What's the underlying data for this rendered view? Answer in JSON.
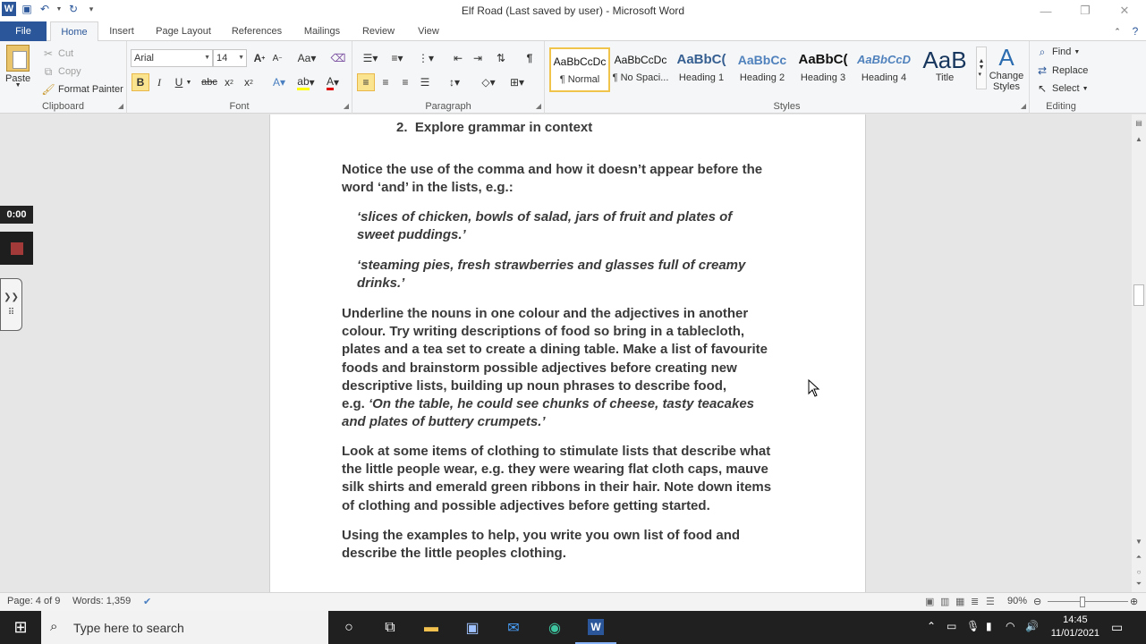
{
  "titlebar": {
    "title": "Elf Road (Last saved by user)  -  Microsoft Word",
    "logo": "W"
  },
  "tabs": [
    "File",
    "Home",
    "Insert",
    "Page Layout",
    "References",
    "Mailings",
    "Review",
    "View"
  ],
  "ribbon": {
    "clipboard": {
      "label": "Clipboard",
      "paste": "Paste",
      "cut": "Cut",
      "copy": "Copy",
      "format_painter": "Format Painter"
    },
    "font": {
      "label": "Font",
      "font_name": "Arial",
      "font_size": "14"
    },
    "paragraph": {
      "label": "Paragraph"
    },
    "styles": {
      "label": "Styles",
      "items": [
        {
          "preview": "AaBbCcDc",
          "name": "¶ Normal"
        },
        {
          "preview": "AaBbCcDc",
          "name": "¶ No Spaci..."
        },
        {
          "preview": "AaBbC(",
          "name": "Heading 1"
        },
        {
          "preview": "AaBbCc",
          "name": "Heading 2"
        },
        {
          "preview": "AaBbC(",
          "name": "Heading 3"
        },
        {
          "preview": "AaBbCcD",
          "name": "Heading 4"
        },
        {
          "preview": "AaB",
          "name": "Title"
        }
      ],
      "change_styles": "Change Styles"
    },
    "editing": {
      "label": "Editing",
      "find": "Find",
      "replace": "Replace",
      "select": "Select"
    }
  },
  "document": {
    "heading": {
      "number": "2.",
      "text": "Explore grammar in context"
    },
    "p1": [
      "Notice the use of the comma and how it doesn’t appear before the",
      "word ‘and’ in the lists, e.g.:"
    ],
    "q1": [
      "‘slices of chicken, bowls of salad, jars of fruit and plates of",
      "sweet puddings.’"
    ],
    "q2": [
      "‘steaming pies, fresh strawberries and glasses full of creamy",
      "drinks.’"
    ],
    "p2": [
      "Underline the nouns in one colour and the adjectives in another",
      "colour. Try writing descriptions of food so bring in a tablecloth,",
      "plates and a tea set to create a dining table. Make a list of favourite",
      "foods and brainstorm possible adjectives before creating new",
      "descriptive lists, building up noun phrases to describe food,"
    ],
    "p2_eg": "e.g. ",
    "p2_italic": [
      "‘On the table, he could see chunks of cheese, tasty teacakes",
      "and plates of buttery crumpets.’"
    ],
    "p3": [
      "Look at some items of clothing to stimulate lists that describe what",
      "the little people wear, e.g. they were wearing flat cloth caps, mauve",
      "silk shirts and emerald green ribbons in their hair. Note down items",
      "of clothing and possible adjectives before getting started."
    ],
    "p4": [
      "Using the examples to help, you write you own list of food and",
      "describe the little peoples clothing."
    ]
  },
  "recorder": {
    "time": "0:00"
  },
  "statusbar": {
    "page": "Page: 4 of 9",
    "words": "Words: 1,359",
    "zoom": "90%"
  },
  "taskbar": {
    "search_placeholder": "Type here to search",
    "time": "14:45",
    "date": "11/01/2021"
  }
}
